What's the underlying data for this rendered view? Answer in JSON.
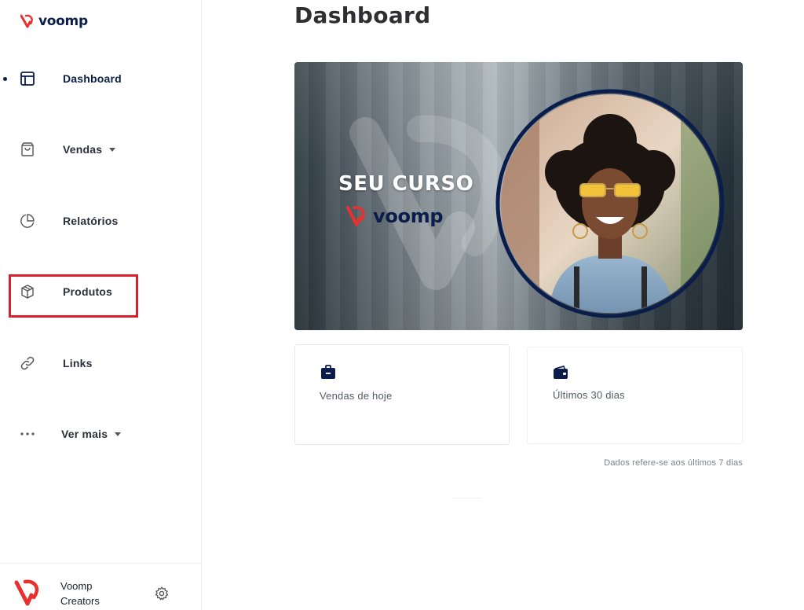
{
  "brand": {
    "name": "voomp",
    "accent": "#e8312f",
    "navy": "#0b1d4a"
  },
  "sidebar": {
    "items": [
      {
        "label": "Dashboard",
        "icon": "layout-icon",
        "active": true
      },
      {
        "label": "Vendas",
        "icon": "shopping-bag-icon",
        "dropdown": true
      },
      {
        "label": "Relatórios",
        "icon": "pie-chart-icon"
      },
      {
        "label": "Produtos",
        "icon": "box-icon",
        "highlighted": true
      },
      {
        "label": "Links",
        "icon": "link-icon"
      },
      {
        "label": "Ver mais",
        "icon": "more-dots-icon",
        "dropdown": true
      }
    ],
    "footer": {
      "name_line1": "Voomp",
      "name_line2": "Creators",
      "settings_icon": "gear-icon"
    }
  },
  "main": {
    "title": "Dashboard",
    "banner": {
      "headline": "SEU CURSO",
      "brand": "voomp"
    },
    "cards": [
      {
        "label": "Vendas de hoje",
        "icon": "briefcase-icon"
      },
      {
        "label": "Últimos 30 dias",
        "icon": "wallet-icon"
      }
    ],
    "note": "Dados refere-se aos últimos 7 dias"
  }
}
